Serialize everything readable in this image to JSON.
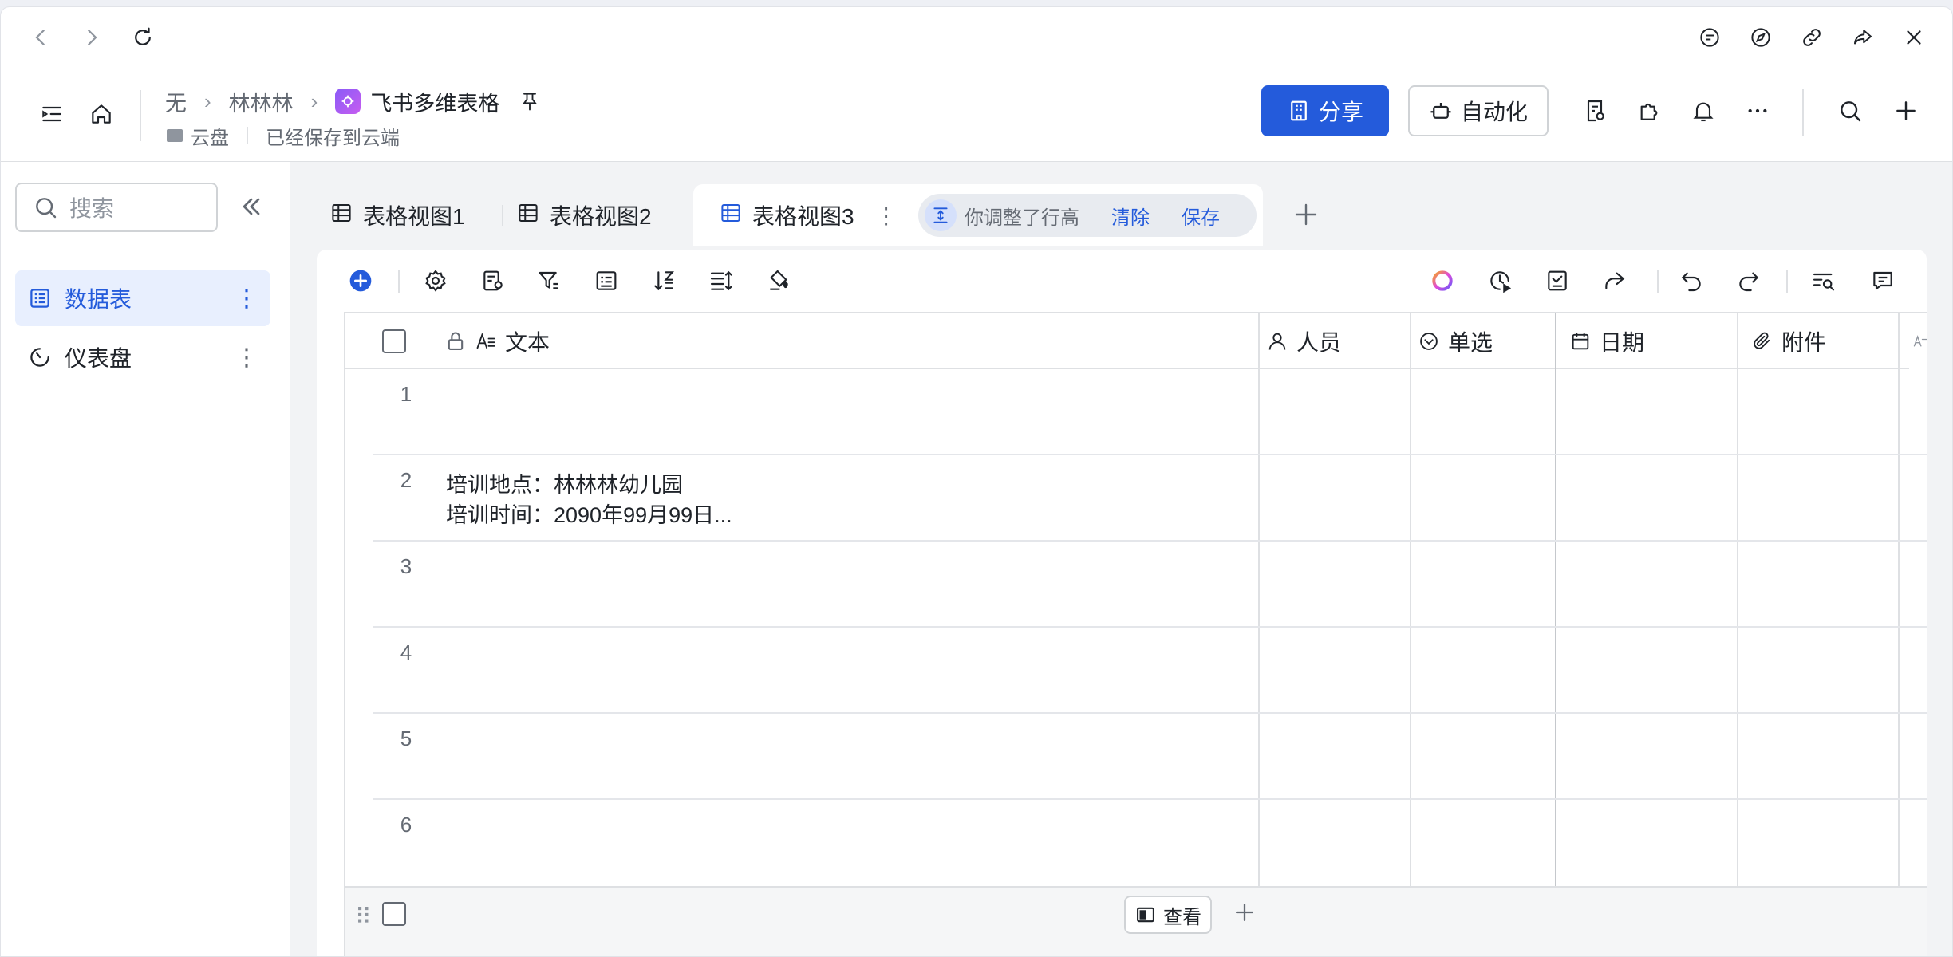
{
  "header": {
    "breadcrumbs": [
      "无",
      "林林林",
      "飞书多维表格"
    ],
    "location": "云盘",
    "save_status": "已经保存到云端",
    "share_label": "分享",
    "automation_label": "自动化"
  },
  "sidebar": {
    "search_placeholder": "搜索",
    "items": [
      {
        "label": "数据表",
        "active": true
      },
      {
        "label": "仪表盘",
        "active": false
      }
    ]
  },
  "tabs": [
    {
      "label": "表格视图1"
    },
    {
      "label": "表格视图2"
    },
    {
      "label": "表格视图3",
      "active": true
    }
  ],
  "notice": {
    "message": "你调整了行高",
    "clear_label": "清除",
    "save_label": "保存"
  },
  "grid": {
    "columns": [
      "文本",
      "人员",
      "单选",
      "日期",
      "附件"
    ],
    "rows": [
      {
        "num": "1",
        "text": ""
      },
      {
        "num": "2",
        "text": "培训地点：林林林幼儿园\n培训时间：2090年99月99日..."
      },
      {
        "num": "3",
        "text": ""
      },
      {
        "num": "4",
        "text": ""
      },
      {
        "num": "5",
        "text": ""
      },
      {
        "num": "6",
        "text": ""
      }
    ],
    "view_label": "查看"
  },
  "colors": {
    "accent": "#245bdb",
    "active_bg": "#e8effe"
  }
}
